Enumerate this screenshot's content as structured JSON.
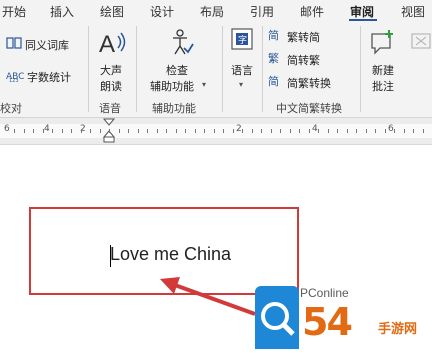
{
  "tabs": [
    {
      "label": "开始"
    },
    {
      "label": "插入"
    },
    {
      "label": "绘图"
    },
    {
      "label": "设计"
    },
    {
      "label": "布局"
    },
    {
      "label": "引用"
    },
    {
      "label": "邮件"
    },
    {
      "label": "审阅"
    },
    {
      "label": "视图"
    }
  ],
  "active_tab": "审阅",
  "ribbon": {
    "proofing": {
      "thesaurus": "同义词库",
      "word_count": "字数统计",
      "group_label": "校对"
    },
    "speech": {
      "read_aloud_line1": "大声",
      "read_aloud_line2": "朗读",
      "group_label": "语音"
    },
    "accessibility": {
      "check_line1": "检查",
      "check_line2": "辅助功能",
      "group_label": "辅助功能"
    },
    "language": {
      "button": "语言"
    },
    "chinese_conversion": {
      "trad_to_simp": "繁转简",
      "simp_to_trad": "简转繁",
      "convert": "简繁转换",
      "group_label": "中文简繁转换"
    },
    "comments": {
      "new_line1": "新建",
      "new_line2": "批注"
    }
  },
  "ruler": {
    "numbers": [
      "6",
      "4",
      "2",
      "2",
      "4",
      "6"
    ]
  },
  "document": {
    "text": "Love me China"
  },
  "watermark": {
    "site": "PConline",
    "big": "54",
    "small": "手游网"
  },
  "colors": {
    "highlight": "#d23a3a",
    "arrow": "#d23a3a",
    "tab_underline": "#2b579a",
    "watermark_blue": "#1e88d6",
    "watermark_orange": "#e26a12"
  }
}
